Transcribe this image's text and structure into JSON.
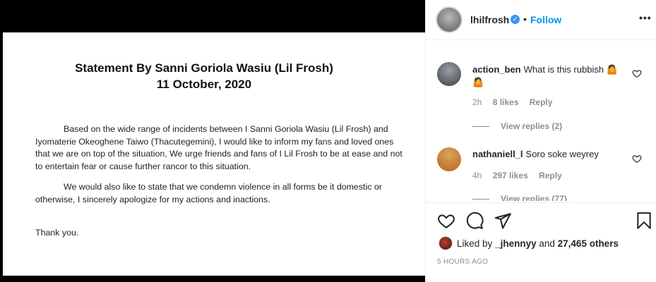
{
  "post_image": {
    "title_line1": "Statement By Sanni Goriola Wasiu (Lil Frosh)",
    "title_line2": "11 October, 2020",
    "paragraph1": "Based on the wide range of incidents between I Sanni Goriola Wasiu (Lil Frosh) and Iyomaterie Okeoghene Taiwo (Thacutegemini), I would like to inform my fans and loved ones that we are on top of the situation, We urge friends and fans of I Lil Frosh to be at ease and not to entertain fear or cause further rancor to this situation.",
    "paragraph2": "We would also like to state that we condemn violence in all forms be it domestic or otherwise,  I sincerely apologize for my actions and inactions.",
    "paragraph3": "Thank you."
  },
  "header": {
    "username": "lhilfrosh",
    "separator": "•",
    "follow_label": "Follow",
    "more_label": "•••"
  },
  "comments": [
    {
      "username": "action_ben",
      "text": "What is this rubbish 🤷 🤷",
      "time": "2h",
      "likes": "8 likes",
      "reply": "Reply",
      "view_replies": "View replies (2)"
    },
    {
      "username": "nathaniell_l",
      "text": "Soro soke weyrey",
      "time": "4h",
      "likes": "297 likes",
      "reply": "Reply",
      "view_replies": "View replies (77)"
    }
  ],
  "likes_section": {
    "liked_by_prefix": "Liked by",
    "liked_by_user": "_jhennyy",
    "and_text": "and",
    "others": "27,465 others",
    "time_ago": "5 HOURS AGO"
  },
  "colors": {
    "accent": "#0095f6",
    "verified": "#3897f0",
    "muted": "#8e8e8e",
    "text": "#262626"
  }
}
